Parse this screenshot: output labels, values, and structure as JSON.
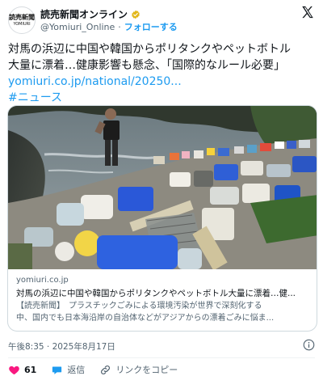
{
  "account": {
    "avatar_line1": "読売新聞",
    "avatar_line2": "YOMIURI",
    "display_name": "読売新聞オンライン",
    "handle": "@Yomiuri_Online",
    "separator": "·",
    "follow_label": "フォローする"
  },
  "post": {
    "text_line1": "対馬の浜辺に中国や韓国からポリタンクやペットボトル",
    "text_line2": "大量に漂着…健康影響も懸念、「国際的なルール必要」",
    "link": "yomiuri.co.jp/national/20250...",
    "hashtag": "#ニュース"
  },
  "card": {
    "domain": "yomiuri.co.jp",
    "title": "対馬の浜辺に中国や韓国からポリタンクやペットボトル大量に漂着…健...",
    "desc_line1": "【読売新聞】　プラスチックごみによる環境汚染が世界で深刻化する",
    "desc_line2": "中、国内でも日本海沿岸の自治体などがアジアからの漂着ごみに悩ま..."
  },
  "timestamp": "午後8:35 · 2025年8月17日",
  "actions": {
    "like_count": "61",
    "reply_label": "返信",
    "copy_link_label": "リンクをコピー"
  },
  "colors": {
    "accent": "#1d9bf0",
    "like": "#f91880",
    "verified_gold": "#e2b719",
    "text_secondary": "#536471"
  }
}
